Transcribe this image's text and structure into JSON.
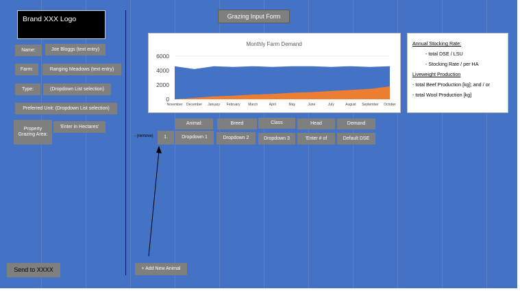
{
  "brand": {
    "logo_text": "Brand XXX Logo"
  },
  "form_title": "Grazing Input Form",
  "fields": {
    "name_label": "Name:",
    "name_value": "Joe Bloggs (text entry)",
    "farm_label": "Farm:",
    "farm_value": "Ranging Meadows (text entry)",
    "type_label": "Type:",
    "type_value": "(Dropdown List selection)",
    "preferred_unit": "Preferred Unit: (Dropdown List selection)",
    "area_label": "Property Grazing Area:",
    "area_value": "'Enter in Hectares'"
  },
  "send_button": "Send to XXXX",
  "animal_table": {
    "headers": [
      "Animal:",
      "Breed",
      "Class",
      "Head",
      "Demand"
    ],
    "remove_label": "- (remove)",
    "row_index": "1.",
    "row": [
      "Dropdown 1",
      "Dropdown 2",
      "Dropdown 3",
      "'Enter # of",
      "Default DSE"
    ]
  },
  "add_animal_button": "+ Add New Animal",
  "stats": {
    "stocking_title": "Annual Stocking Rate:",
    "stocking_items": [
      "- total DSE / LSU",
      "- Stocking Rate / per HA"
    ],
    "production_title": "Liveweight Production",
    "production_items": [
      "- total Beef Production [kg]; and / or",
      "- total Wool Production [kg]"
    ]
  },
  "colors": {
    "background": "#4472c4",
    "box": "#7f7f7f",
    "series_blue": "#4472c4",
    "series_orange": "#ed7d31"
  },
  "chart_data": {
    "type": "area",
    "title": "Monthly Farm Demand",
    "categories": [
      "November",
      "December",
      "January",
      "February",
      "March",
      "April",
      "May",
      "June",
      "July",
      "August",
      "September",
      "October"
    ],
    "series": [
      {
        "values": [
          4600,
          4200,
          4600,
          4500,
          4600,
          4500,
          4600,
          4600,
          4500,
          4600,
          4500,
          4600
        ]
      },
      {
        "values": [
          0,
          200,
          400,
          500,
          650,
          750,
          900,
          1000,
          1150,
          1300,
          1450,
          1800
        ]
      }
    ],
    "yticks": [
      "0",
      "2000",
      "4000",
      "6000"
    ],
    "ylim": [
      0,
      6000
    ],
    "grid": true,
    "legend": "none"
  }
}
